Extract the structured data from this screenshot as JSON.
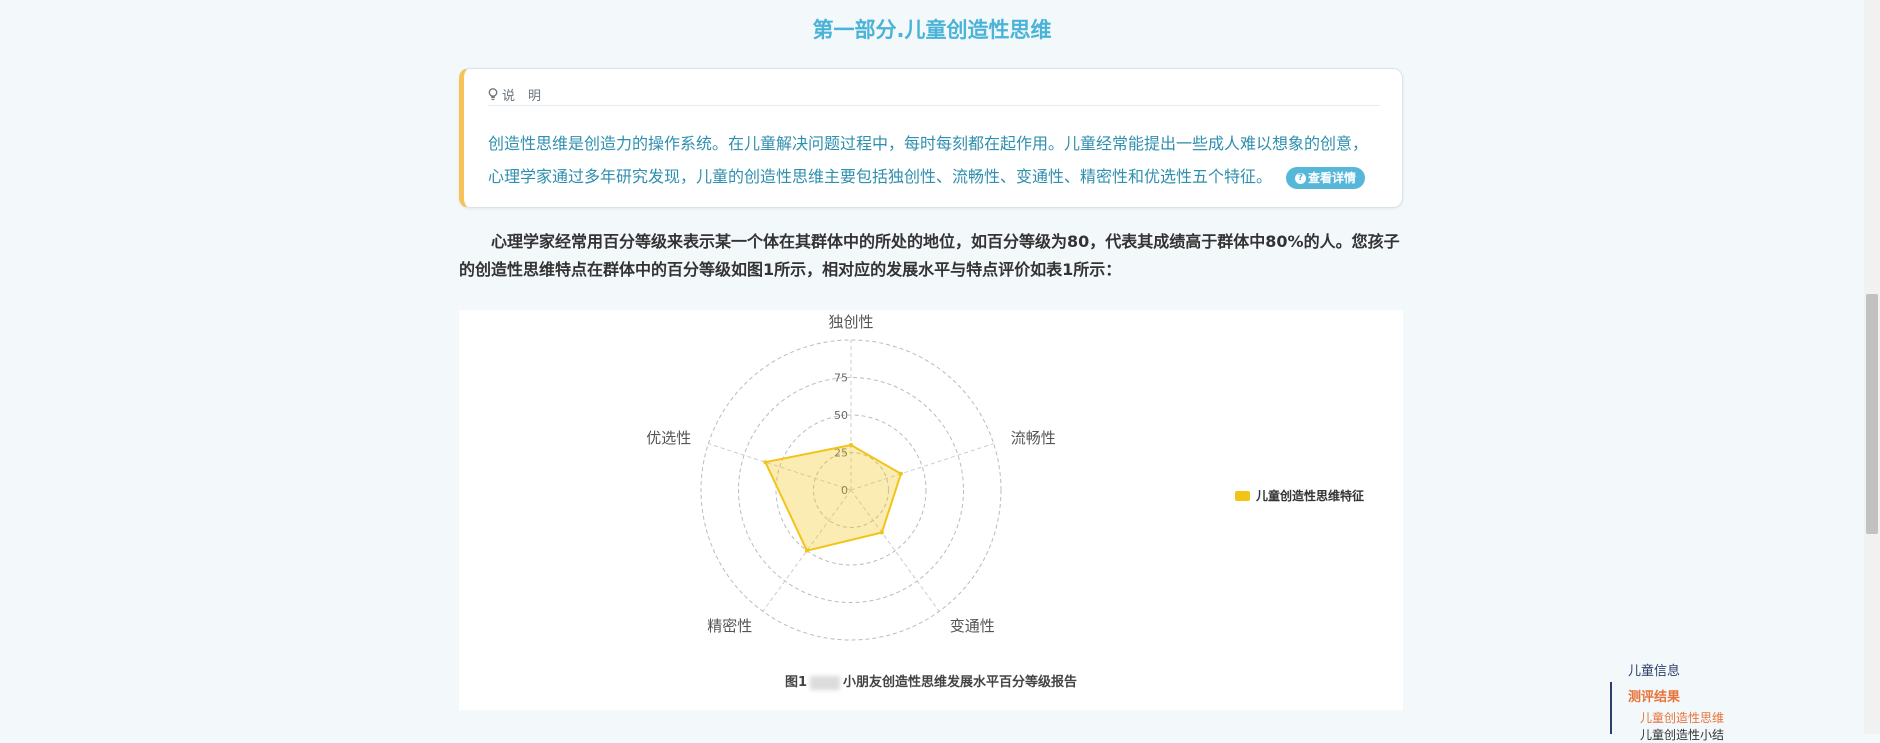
{
  "page": {
    "title": "第一部分.儿童创造性思维"
  },
  "note": {
    "header": "说　明",
    "body": "创造性思维是创造力的操作系统。在儿童解决问题过程中，每时每刻都在起作用。儿童经常能提出一些成人难以想象的创意，心理学家通过多年研究发现，儿童的创造性思维主要包括独创性、流畅性、变通性、精密性和优选性五个特征。",
    "detail_button": "查看详情"
  },
  "intro_text": "心理学家经常用百分等级来表示某一个体在其群体中的所处的地位，如百分等级为80，代表其成绩高于群体中80%的人。您孩子的创造性思维特点在群体中的百分等级如图1所示，相对应的发展水平与特点评价如表1所示：",
  "chart_data": {
    "type": "radar",
    "indicators": [
      "独创性",
      "流畅性",
      "变通性",
      "精密性",
      "优选性"
    ],
    "radial_ticks": [
      0,
      25,
      50,
      75
    ],
    "range": [
      0,
      100
    ],
    "series": [
      {
        "name": "儿童创造性思维特征",
        "values": [
          30,
          35,
          35,
          50,
          60
        ]
      }
    ],
    "colors": {
      "line": "#f2c418",
      "fill": "rgba(242,196,24,0.33)",
      "grid": "#bbbbbb"
    },
    "legend": "right",
    "caption_prefix": "图1",
    "caption_suffix": "小朋友创造性思维发展水平百分等级报告"
  },
  "toc": {
    "items": [
      "儿童信息",
      "测评结果",
      "儿童创造性思维",
      "儿童创造性小结"
    ]
  }
}
